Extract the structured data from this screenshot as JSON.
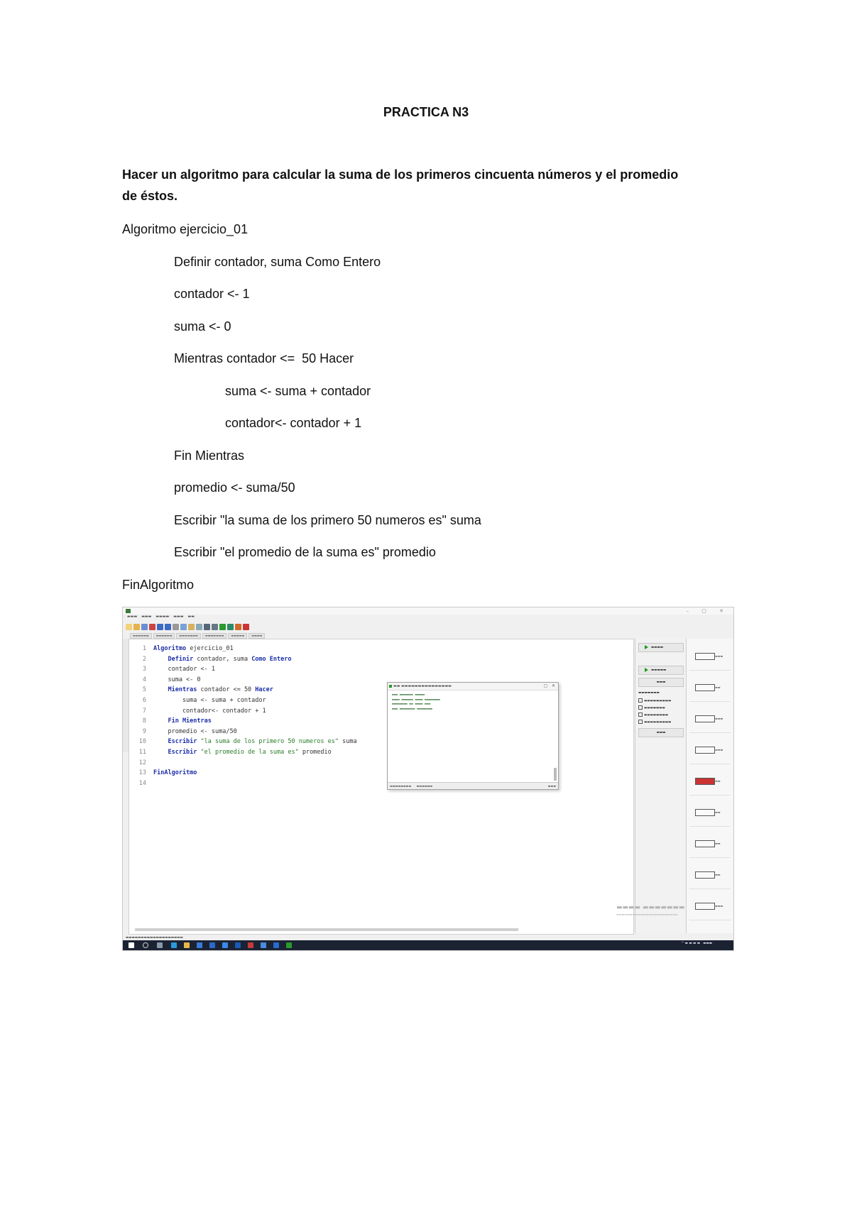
{
  "document": {
    "title": "PRACTICA N3",
    "statement": [
      "Hacer un algoritmo para calcular la suma de los primeros cincuenta números y el promedio",
      "de éstos."
    ],
    "algorithm": [
      "Algoritmo ejercicio_01",
      "Definir contador, suma Como Entero",
      "contador <- 1",
      "suma <- 0",
      "Mientras contador <=  50 Hacer",
      "suma <- suma + contador",
      "contador<- contador + 1",
      "Fin Mientras",
      "promedio <- suma/50",
      "Escribir \"la suma de los primero 50 numeros es\" suma",
      "Escribir \"el promedio de la suma es\" promedio",
      "FinAlgoritmo"
    ]
  },
  "screenshot": {
    "code_lines": [
      {
        "n": "1",
        "parts": [
          {
            "t": "Algoritmo ",
            "c": "kw"
          },
          {
            "t": "ejercicio_01",
            "c": "tx"
          }
        ]
      },
      {
        "n": "2",
        "parts": [
          {
            "t": "    Definir ",
            "c": "kw"
          },
          {
            "t": "contador, suma ",
            "c": "tx"
          },
          {
            "t": "Como Entero",
            "c": "kw"
          }
        ]
      },
      {
        "n": "3",
        "parts": [
          {
            "t": "    contador <- 1",
            "c": "tx"
          }
        ]
      },
      {
        "n": "4",
        "parts": [
          {
            "t": "    suma <- 0",
            "c": "tx"
          }
        ]
      },
      {
        "n": "5",
        "parts": [
          {
            "t": "    Mientras ",
            "c": "kw"
          },
          {
            "t": "contador <= 50 ",
            "c": "tx"
          },
          {
            "t": "Hacer",
            "c": "kw"
          }
        ]
      },
      {
        "n": "6",
        "parts": [
          {
            "t": "        suma <- suma + contador",
            "c": "tx"
          }
        ]
      },
      {
        "n": "7",
        "parts": [
          {
            "t": "        contador<- contador + 1",
            "c": "tx"
          }
        ]
      },
      {
        "n": "8",
        "parts": [
          {
            "t": "    Fin Mientras",
            "c": "kw"
          }
        ]
      },
      {
        "n": "9",
        "parts": [
          {
            "t": "    promedio <- suma/50",
            "c": "tx"
          }
        ]
      },
      {
        "n": "10",
        "parts": [
          {
            "t": "    Escribir ",
            "c": "kw"
          },
          {
            "t": "\"la suma de los primero 50 numeros es\" ",
            "c": "st"
          },
          {
            "t": "suma",
            "c": "tx"
          }
        ]
      },
      {
        "n": "11",
        "parts": [
          {
            "t": "    Escribir ",
            "c": "kw"
          },
          {
            "t": "\"el promedio de la suma es\" ",
            "c": "st"
          },
          {
            "t": "promedio",
            "c": "tx"
          }
        ]
      },
      {
        "n": "12",
        "parts": [
          {
            "t": "",
            "c": "tx"
          }
        ]
      },
      {
        "n": "13",
        "parts": [
          {
            "t": "FinAlgoritmo",
            "c": "kw"
          }
        ]
      },
      {
        "n": "14",
        "parts": [
          {
            "t": "",
            "c": "tx"
          }
        ]
      }
    ]
  }
}
